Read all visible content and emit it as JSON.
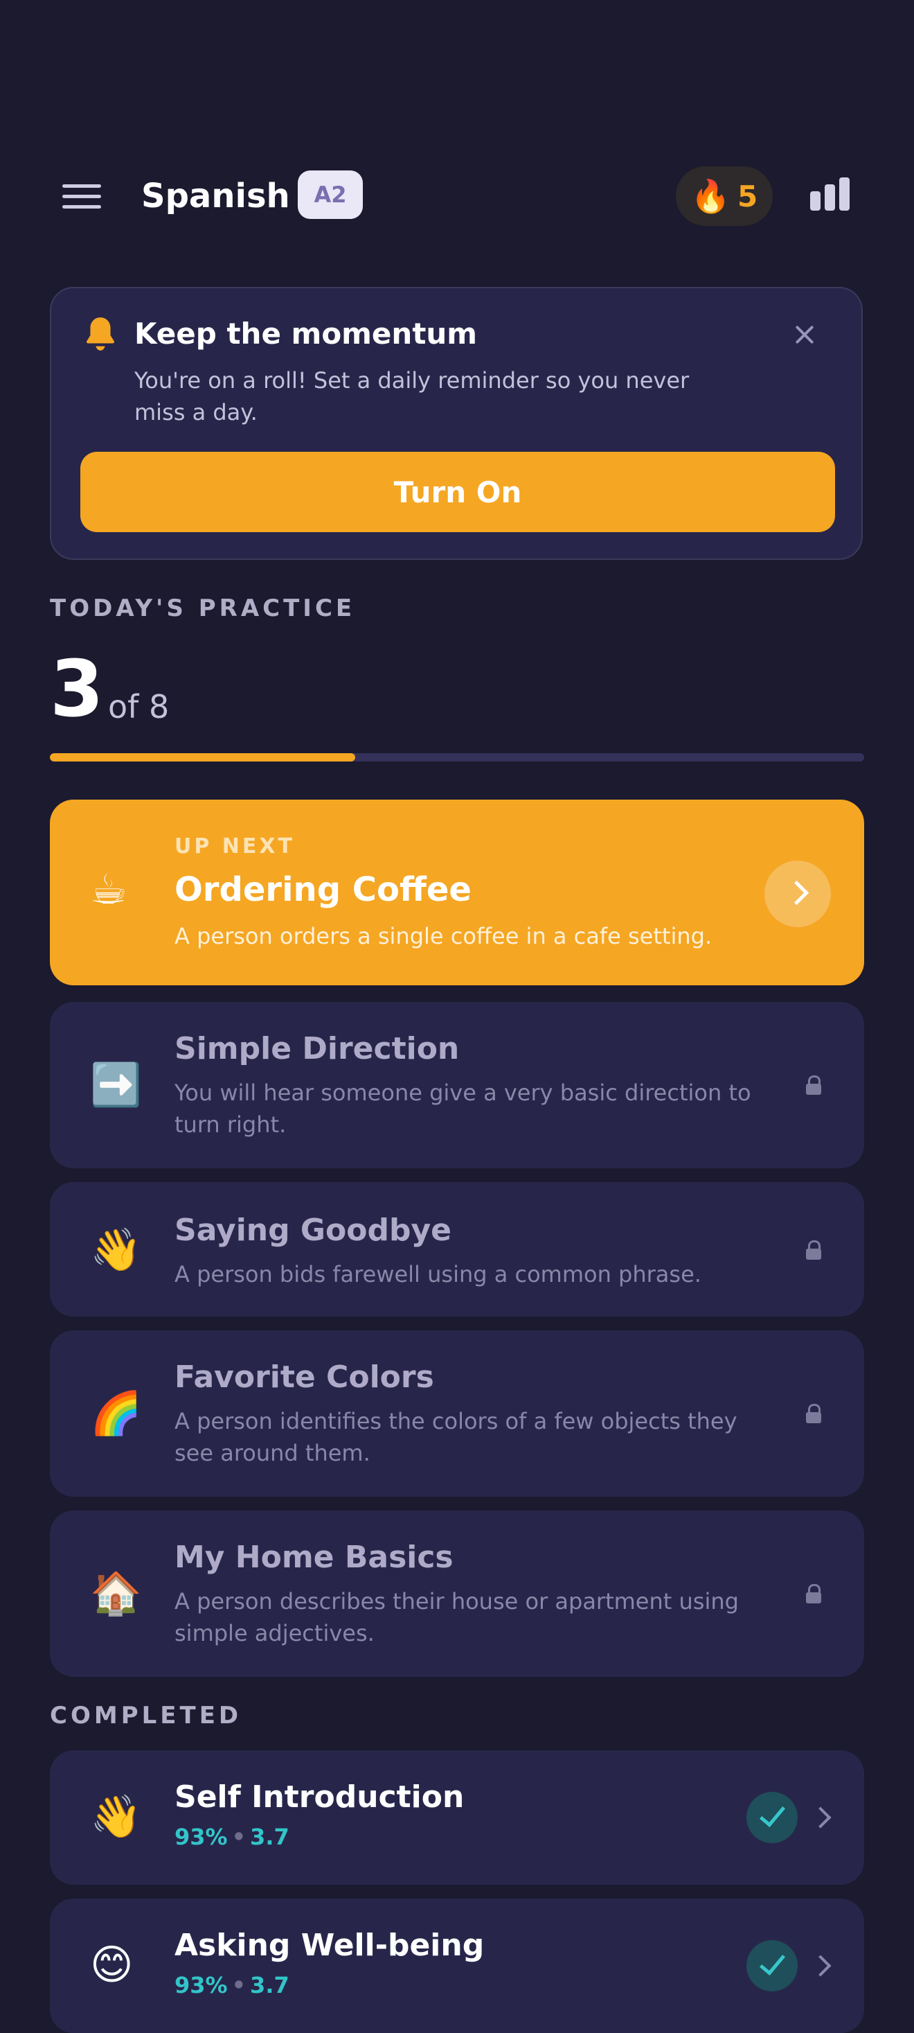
{
  "header": {
    "language": "Spanish",
    "level": "A2",
    "streak_icon": "fire-icon",
    "streak_count": "5",
    "menu_icon": "hamburger-menu-icon",
    "stats_icon": "bar-chart-icon"
  },
  "reminder": {
    "icon": "bell-icon",
    "title": "Keep the momentum",
    "body": "You're on a roll! Set a daily reminder so you never miss a day.",
    "button_label": "Turn On",
    "close_icon": "close-icon"
  },
  "practice": {
    "section_label": "TODAY'S PRACTICE",
    "done_count": "3",
    "total_label": "of 8",
    "progress_fraction": 0.375
  },
  "up_next": {
    "tag": "UP NEXT",
    "emoji": "☕",
    "title": "Ordering Coffee",
    "description": "A person orders a single coffee in a cafe setting."
  },
  "locked_lessons": [
    {
      "emoji": "➡️",
      "title": "Simple Direction",
      "description": "You will hear someone give a very basic direction to turn right."
    },
    {
      "emoji": "👋",
      "title": "Saying Goodbye",
      "description": "A person bids farewell using a common phrase."
    },
    {
      "emoji": "🌈",
      "title": "Favorite Colors",
      "description": "A person identifies the colors of a few objects they see around them."
    },
    {
      "emoji": "🏠",
      "title": "My Home Basics",
      "description": "A person describes their house or apartment using simple adjectives."
    }
  ],
  "completed": {
    "section_label": "COMPLETED",
    "items": [
      {
        "emoji": "👋",
        "title": "Self Introduction",
        "score": "93%",
        "rating": "3.7"
      },
      {
        "emoji": "😊",
        "title": "Asking Well-being",
        "score": "93%",
        "rating": "3.7"
      }
    ]
  },
  "colors": {
    "background": "#1b1a2e",
    "card": "#27264a",
    "accent": "#f5a623",
    "success": "#33c5c9"
  }
}
